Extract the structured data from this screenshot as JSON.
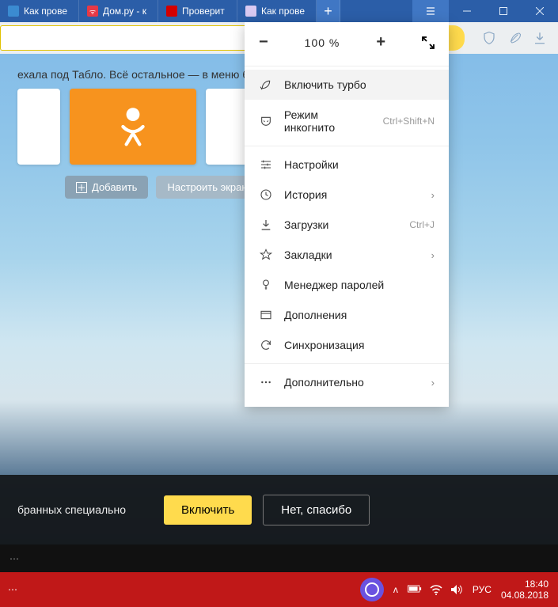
{
  "tabs": [
    {
      "favColor": "#3b8bd1",
      "favText": "",
      "label": "Как прове"
    },
    {
      "favColor": "#e63946",
      "favText": "",
      "label": "Дом.ру - к"
    },
    {
      "favColor": "#d40000",
      "favText": "",
      "label": "Проверит"
    },
    {
      "favColor": "#6a52e0",
      "favText": "",
      "label": "Как прове"
    }
  ],
  "newTab": "+",
  "zoom": {
    "minus": "−",
    "value": "100 %",
    "plus": "+"
  },
  "menu": {
    "turbo": "Включить турбо",
    "incognito": "Режим инкогнито",
    "incognito_sc": "Ctrl+Shift+N",
    "settings": "Настройки",
    "history": "История",
    "downloads": "Загрузки",
    "downloads_sc": "Ctrl+J",
    "bookmarks": "Закладки",
    "passwords": "Менеджер паролей",
    "addons": "Дополнения",
    "sync": "Синхронизация",
    "more": "Дополнительно"
  },
  "page": {
    "hint": "ехала под Табло. Всё остальное — в меню браузер",
    "add": "Добавить",
    "configure": "Настроить экран"
  },
  "promo": {
    "text": "бранных специально",
    "enable": "Включить",
    "decline": "Нет, спасибо"
  },
  "footer_dots": "⋯",
  "taskbar": {
    "chevron": "ʌ",
    "lang": "РУС",
    "time": "18:40",
    "date": "04.08.2018"
  }
}
